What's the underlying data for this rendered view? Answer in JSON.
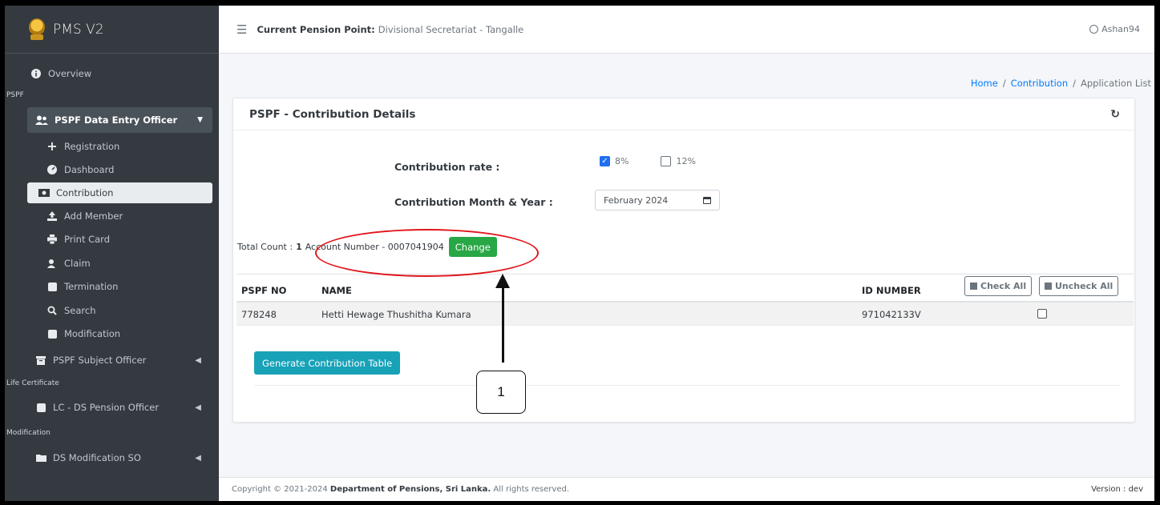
{
  "brand": {
    "name": "PMS V2"
  },
  "sidebar": {
    "overview": "Overview",
    "header_pspf": "PSPF",
    "pspf_officer": "PSPF Data Entry Officer",
    "items": [
      {
        "label": "Registration",
        "icon": "plus-icon"
      },
      {
        "label": "Dashboard",
        "icon": "dashboard-icon"
      },
      {
        "label": "Contribution",
        "icon": "money-icon"
      },
      {
        "label": "Add Member",
        "icon": "upload-icon"
      },
      {
        "label": "Print Card",
        "icon": "print-icon"
      },
      {
        "label": "Claim",
        "icon": "user-search-icon"
      },
      {
        "label": "Termination",
        "icon": "termination-icon"
      },
      {
        "label": "Search",
        "icon": "search-icon"
      },
      {
        "label": "Modification",
        "icon": "modification-icon"
      }
    ],
    "subject_officer": "PSPF Subject Officer",
    "header_life": "Life Certificate",
    "lc_officer": "LC - DS Pension Officer",
    "header_mod": "Modification",
    "ds_mod": "DS Modification SO"
  },
  "topbar": {
    "label": "Current Pension Point:",
    "value": "Divisional Secretariat - Tangalle",
    "user": "Ashan94"
  },
  "breadcrumb": {
    "home": "Home",
    "section": "Contribution",
    "current": "Application List",
    "sep": "/"
  },
  "card": {
    "title": "PSPF - Contribution Details"
  },
  "form": {
    "rate_label": "Contribution rate :",
    "rate_8": "8%",
    "rate_12": "12%",
    "month_label": "Contribution Month & Year :",
    "month_value": "February 2024"
  },
  "count": {
    "label": "Total Count :",
    "value": "1",
    "account": "Account Number - 0007041904",
    "change": "Change"
  },
  "table": {
    "headers": [
      "PSPF NO",
      "NAME",
      "ID NUMBER"
    ],
    "check_all": "Check All",
    "uncheck_all": "Uncheck All",
    "rows": [
      {
        "pspf_no": "778248",
        "name": "Hetti Hewage Thushitha Kumara",
        "id_number": "971042133V"
      }
    ]
  },
  "generate_button": "Generate Contribution Table",
  "footer": {
    "prefix": "Copyright © 2021-2024",
    "org": "Department of Pensions, Sri Lanka.",
    "suffix": "All rights reserved.",
    "version": "Version : dev"
  },
  "annotation": {
    "callout": "1"
  },
  "colors": {
    "sidebar": "#343a40",
    "accent_green": "#28a745",
    "accent_teal": "#17a2b8",
    "annotation_red": "#e0161b"
  }
}
